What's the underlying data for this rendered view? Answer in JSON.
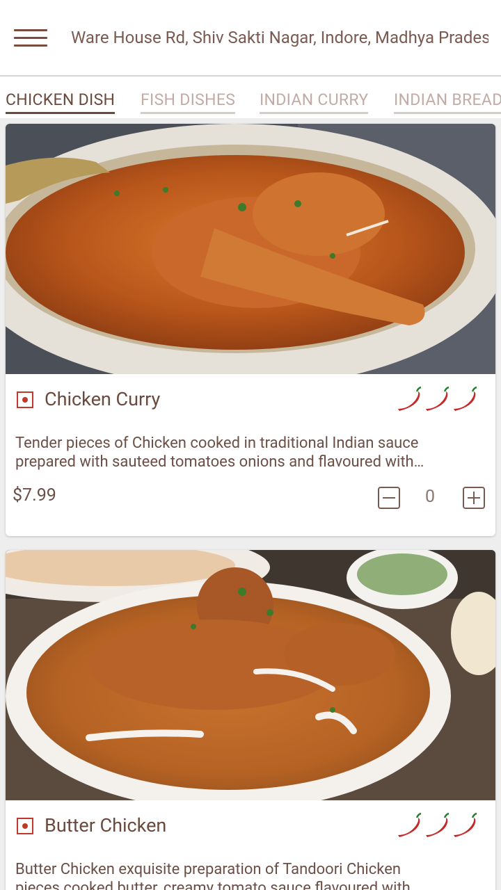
{
  "header": {
    "address": "Ware House Rd, Shiv Sakti Nagar, Indore, Madhya Pradesh"
  },
  "tabs": [
    {
      "label": "CHICKEN DISH",
      "active": true
    },
    {
      "label": "FISH DISHES",
      "active": false
    },
    {
      "label": "INDIAN CURRY",
      "active": false
    },
    {
      "label": "INDIAN BREAD",
      "active": false
    }
  ],
  "colors": {
    "accent": "#6b4a3e",
    "veg_mark": "#c0392b",
    "chili": "#c62828"
  },
  "menu_items": [
    {
      "name": "Chicken Curry",
      "spice_level": 3,
      "description_line1": "Tender pieces of Chicken cooked in traditional Indian sauce",
      "description_line2": "prepared with sauteed tomatoes onions and flavoured with…",
      "price": "$7.99",
      "quantity": "0"
    },
    {
      "name": "Butter Chicken",
      "spice_level": 3,
      "description_line1": "Butter Chicken exquisite preparation of Tandoori Chicken",
      "description_line2": "pieces cooked butter, creamy tomato sauce flavoured with…"
    }
  ]
}
